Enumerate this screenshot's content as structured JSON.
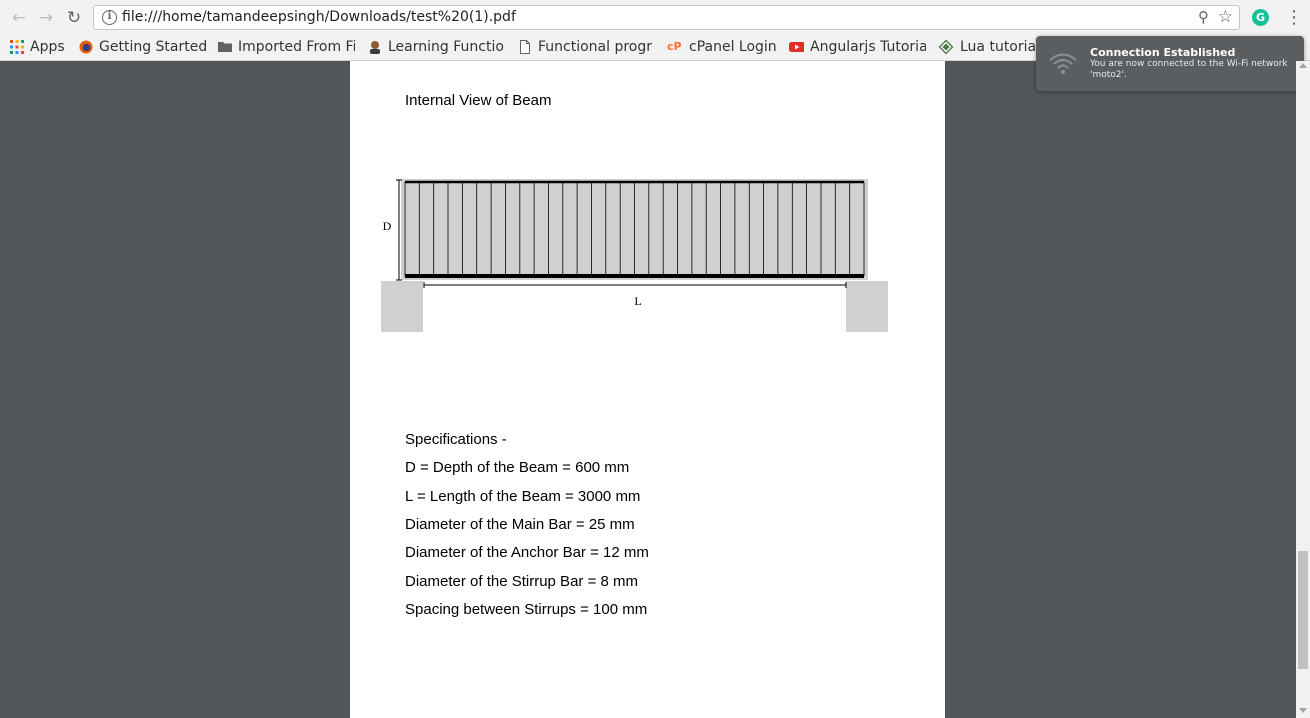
{
  "browser": {
    "url": "file:///home/tamandeepsingh/Downloads/test%20(1).pdf",
    "back_icon": "arrow-left-icon",
    "forward_icon": "arrow-right-icon",
    "reload_icon": "reload-icon",
    "extension_letter": "G"
  },
  "bookmarks": [
    {
      "label": "Apps",
      "icon": "apps-grid-icon"
    },
    {
      "label": "Getting Started",
      "icon": "firefox-icon"
    },
    {
      "label": "Imported From Fi",
      "icon": "folder-icon"
    },
    {
      "label": "Learning Functio",
      "icon": "avatar-icon"
    },
    {
      "label": "Functional progr",
      "icon": "page-icon"
    },
    {
      "label": "cPanel Login",
      "icon": "cpanel-icon"
    },
    {
      "label": "Angularjs Tutoria",
      "icon": "youtube-icon"
    },
    {
      "label": "Lua tutorial",
      "icon": "lua-icon"
    }
  ],
  "notification": {
    "title": "Connection Established",
    "body": "You are now connected to the Wi-Fi network 'moto2'."
  },
  "pdf": {
    "heading": "Internal View of Beam",
    "diagram_labels": {
      "depth": "D",
      "length": "L"
    },
    "spec_title": "Specifications -",
    "specs": [
      "D = Depth of the Beam = 600 mm",
      "L = Length of the Beam = 3000 mm",
      "Diameter of the Main Bar = 25 mm",
      "Diameter of the Anchor Bar = 12 mm",
      "Diameter of the Stirrup Bar = 8 mm",
      "Spacing between Stirrups = 100 mm"
    ]
  }
}
